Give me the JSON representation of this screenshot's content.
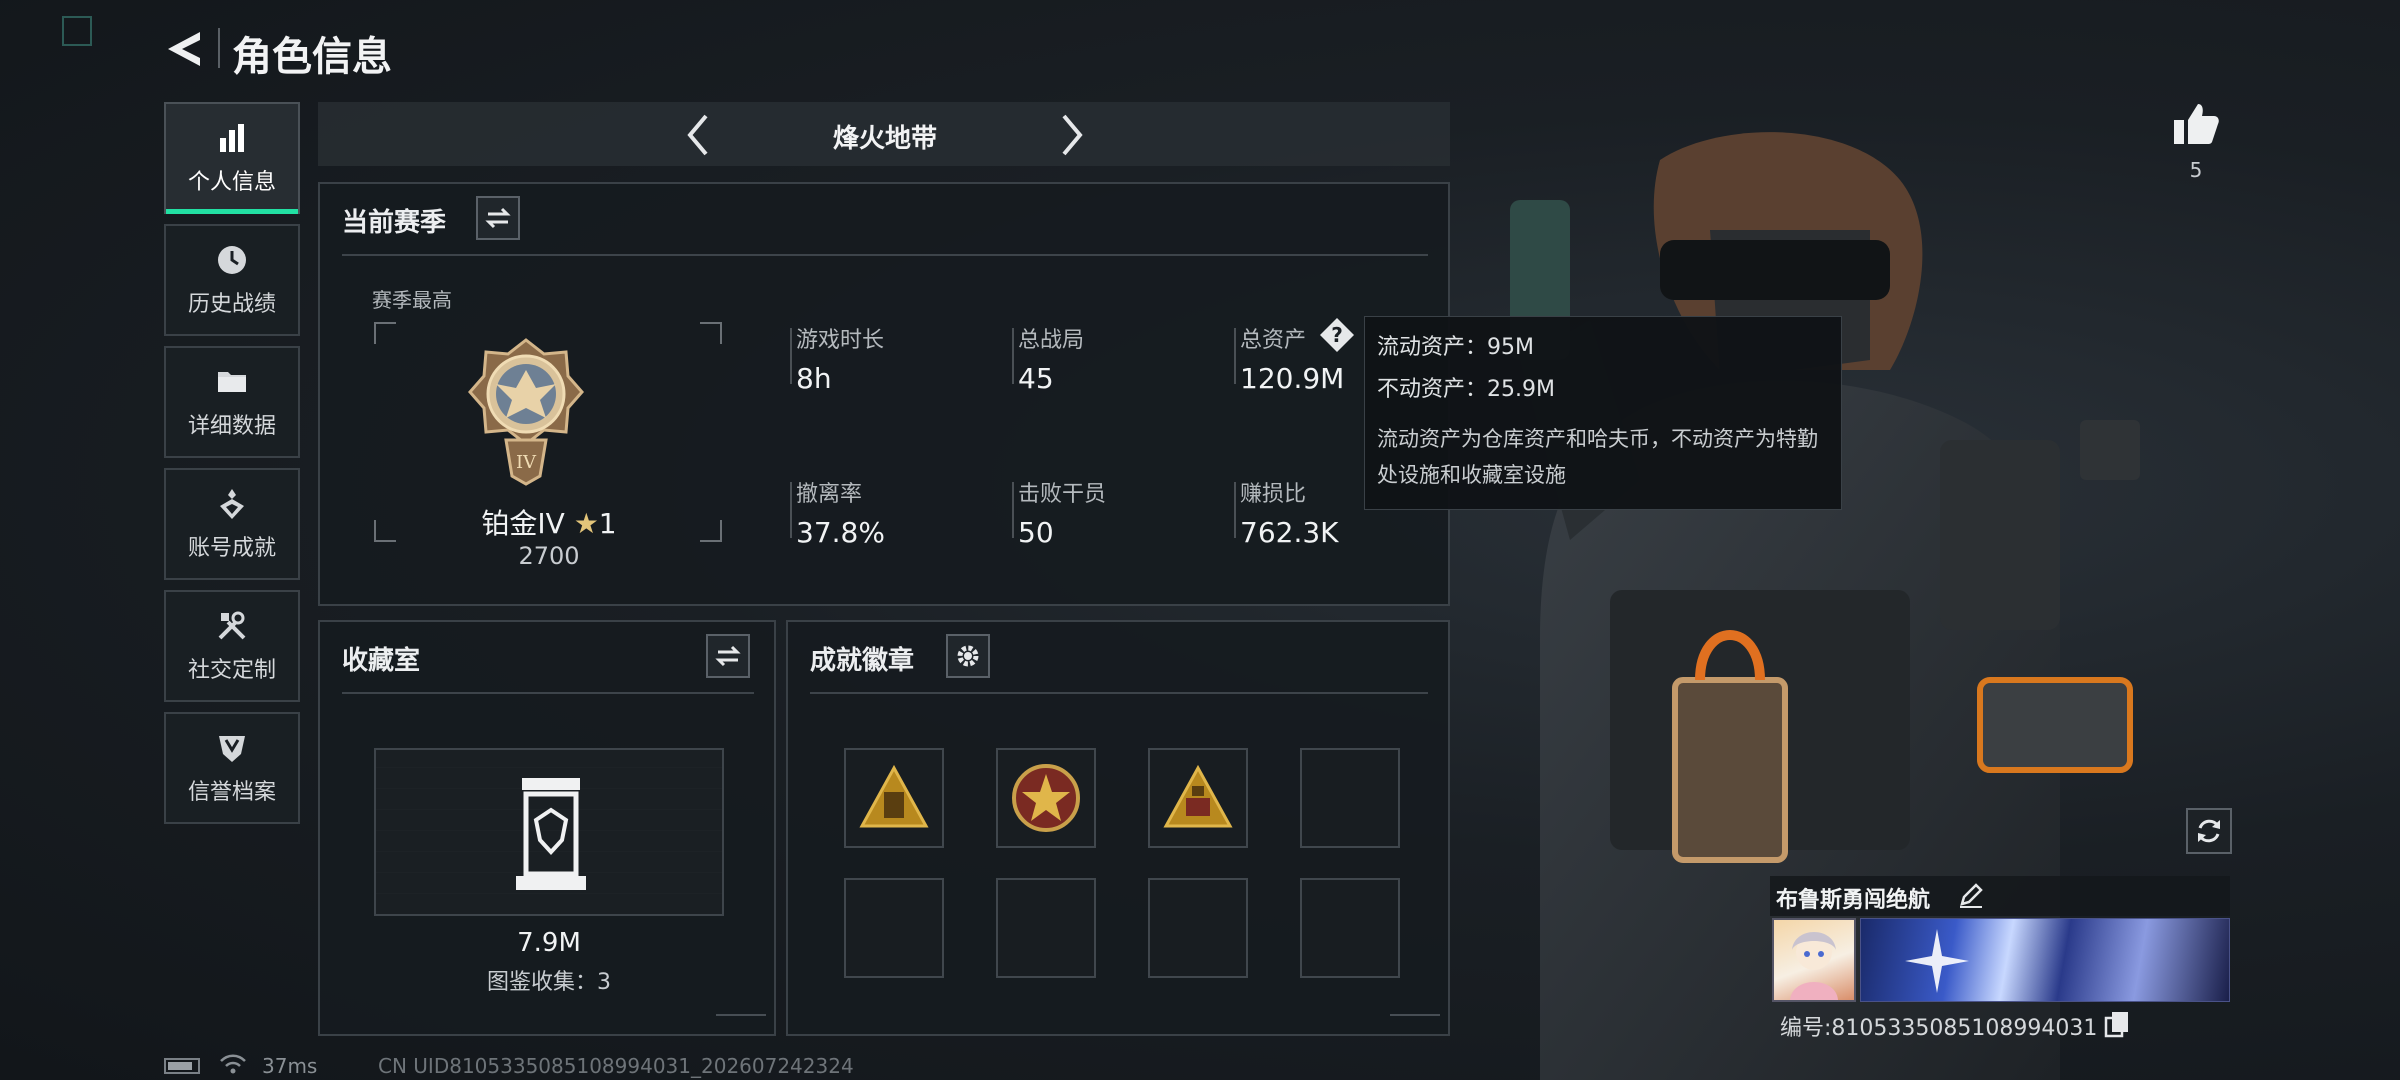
{
  "header": {
    "title": "角色信息"
  },
  "sidebar": {
    "items": [
      {
        "label": "个人信息",
        "icon": "bar-chart-icon",
        "active": true
      },
      {
        "label": "历史战绩",
        "icon": "clock-icon",
        "active": false
      },
      {
        "label": "详细数据",
        "icon": "folder-icon",
        "active": false
      },
      {
        "label": "账号成就",
        "icon": "achievement-icon",
        "active": false
      },
      {
        "label": "社交定制",
        "icon": "tools-icon",
        "active": false
      },
      {
        "label": "信誉档案",
        "icon": "shield-icon",
        "active": false
      }
    ]
  },
  "mode_selector": {
    "title": "烽火地带"
  },
  "season": {
    "header": "当前赛季",
    "best_label": "赛季最高",
    "rank": {
      "name": "铂金IV",
      "stars": "1",
      "score": "2700",
      "emblem_numeral": "IV"
    },
    "stats": [
      {
        "label": "游戏时长",
        "value": "8h"
      },
      {
        "label": "总战局",
        "value": "45"
      },
      {
        "label": "总资产",
        "value": "120.9M"
      },
      {
        "label": "撤离率",
        "value": "37.8%"
      },
      {
        "label": "击败干员",
        "value": "50"
      },
      {
        "label": "赚损比",
        "value": "762.3K"
      }
    ],
    "help_glyph": "?"
  },
  "tooltip": {
    "liquid": "流动资产：95M",
    "fixed": "不动资产：25.9M",
    "desc": "流动资产为仓库资产和哈夫币，不动资产为特勤处设施和收藏室设施"
  },
  "collection": {
    "header": "收藏室",
    "value": "7.9M",
    "count": "图鉴收集：3"
  },
  "badges": {
    "header": "成就徽章"
  },
  "player": {
    "likes": "5",
    "name": "布鲁斯勇闯绝航",
    "id": "编号:8105335085108994031"
  },
  "status_bar": {
    "ping": "37ms",
    "uid": "CN UID8105335085108994031_202607242324"
  },
  "colors": {
    "accent": "#22e0a3",
    "panel_bg": "#161b1f",
    "border": "#3a4147"
  }
}
